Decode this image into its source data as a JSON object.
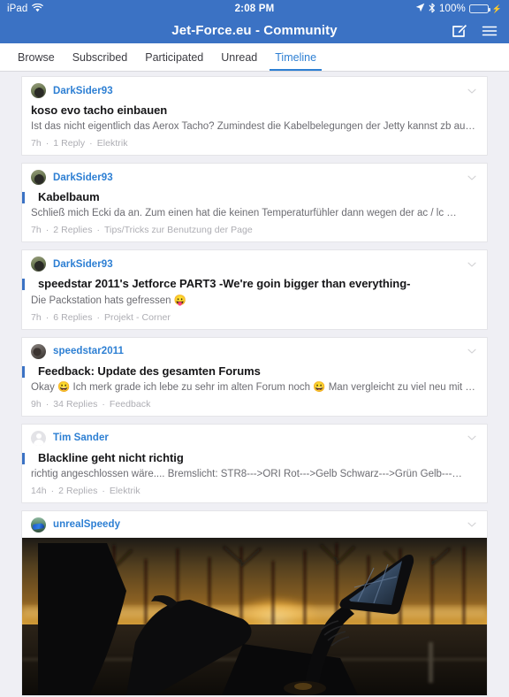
{
  "status_bar": {
    "device": "iPad",
    "wifi_icon": "wifi-icon",
    "time": "2:08 PM",
    "location_icon": "location-arrow-icon",
    "bluetooth_icon": "bluetooth-icon",
    "battery_percent": "100%",
    "battery_icon": "battery-full-icon",
    "charging_icon": "lightning-bolt-icon"
  },
  "navbar": {
    "title": "Jet-Force.eu - Community",
    "compose_icon": "compose-icon",
    "menu_icon": "hamburger-menu-icon"
  },
  "tabs": [
    {
      "label": "Browse",
      "active": false
    },
    {
      "label": "Subscribed",
      "active": false
    },
    {
      "label": "Participated",
      "active": false
    },
    {
      "label": "Unread",
      "active": false
    },
    {
      "label": "Timeline",
      "active": true
    }
  ],
  "colors": {
    "accent": "#3b72c4",
    "tab_active": "#2d7fd3",
    "username": "#2d7fd3",
    "unread_bar": "#3b72c4",
    "page_bg": "#efeff4",
    "card_bg": "#ffffff",
    "title_text": "#161618",
    "snippet_text": "#6c6c72",
    "meta_text": "#adadb3",
    "battery_green": "#4cd964"
  },
  "feed": [
    {
      "username": "DarkSider93",
      "avatar": "avatar-darksider93",
      "unread": false,
      "title": "koso evo tacho einbauen",
      "snippet": "Ist das nicht eigentlich das Aerox Tacho? Zumindest die Kabelbelegungen der Jetty kannst zb aus …",
      "time": "7h",
      "replies": "1 Reply",
      "forum": "Elektrik",
      "chevron_icon": "chevron-down-icon"
    },
    {
      "username": "DarkSider93",
      "avatar": "avatar-darksider93",
      "unread": true,
      "title": "Kabelbaum",
      "snippet": "Schließ mich Ecki da an. Zum einen hat die keinen Temperaturfühler dann wegen der ac / lc …",
      "time": "7h",
      "replies": "2 Replies",
      "forum": "Tips/Tricks zur Benutzung der Page",
      "chevron_icon": "chevron-down-icon"
    },
    {
      "username": "DarkSider93",
      "avatar": "avatar-darksider93",
      "unread": true,
      "title": "speedstar 2011's Jetforce PART3 -We're goin bigger than everything-",
      "snippet": "Die Packstation hats gefressen 😛",
      "time": "7h",
      "replies": "6 Replies",
      "forum": "Projekt - Corner",
      "chevron_icon": "chevron-down-icon"
    },
    {
      "username": "speedstar2011",
      "avatar": "avatar-speedstar2011",
      "unread": true,
      "title": "Feedback: Update des gesamten Forums",
      "snippet": "Okay 😀 Ich merk grade ich lebe zu sehr im alten Forum noch 😀  Man vergleicht zu viel neu mit al…",
      "time": "9h",
      "replies": "34 Replies",
      "forum": "Feedback",
      "chevron_icon": "chevron-down-icon"
    },
    {
      "username": "Tim Sander",
      "avatar": "avatar-default-person",
      "unread": true,
      "title": "Blackline geht nicht richtig",
      "snippet": "richtig angeschlossen wäre....  Bremslicht: STR8--->ORI  Rot--->Gelb Schwarz--->Grün Gelb---…",
      "time": "14h",
      "replies": "2 Replies",
      "forum": "Elektrik",
      "chevron_icon": "chevron-down-icon"
    },
    {
      "username": "unrealSpeedy",
      "avatar": "avatar-unrealspeedy",
      "unread": false,
      "has_photo": true,
      "photo_description": "Scooter mirror and seat silhouetted against an orange sunset behind bare trees",
      "chevron_icon": "chevron-down-icon"
    }
  ]
}
